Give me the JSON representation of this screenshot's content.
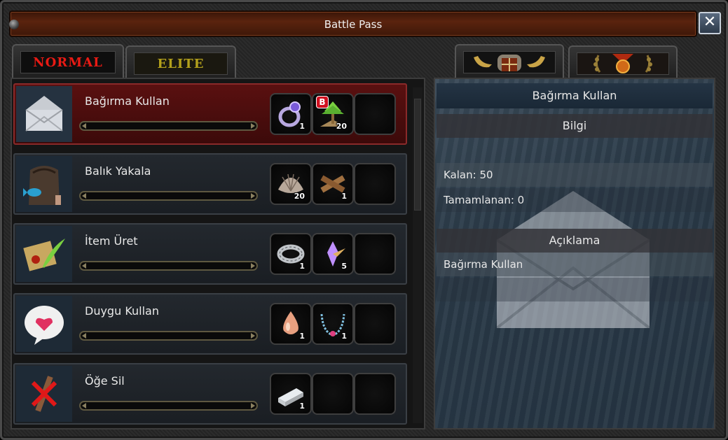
{
  "window": {
    "title": "Battle Pass",
    "close_symbol": "✕"
  },
  "tabs": {
    "normal": "NORMAL",
    "elite": "ELITE",
    "right_tab_1_icon": "gate-horns-icon",
    "right_tab_2_icon": "medal-laurel-icon"
  },
  "quests": [
    {
      "name": "Bağırma Kullan",
      "icon": "envelope-icon",
      "selected": true,
      "progress": 0,
      "rewards": [
        {
          "icon": "ring-icon",
          "count": "1"
        },
        {
          "icon": "tree-icon",
          "count": "20",
          "badge": "B"
        },
        {
          "icon": "empty-slot"
        }
      ]
    },
    {
      "name": "Balık Yakala",
      "icon": "fish-icon",
      "selected": false,
      "progress": 0,
      "rewards": [
        {
          "icon": "shell-icon",
          "count": "20"
        },
        {
          "icon": "wood-icon",
          "count": "1"
        },
        {
          "icon": "empty-slot"
        }
      ]
    },
    {
      "name": "İtem Üret",
      "icon": "scroll-feather-icon",
      "selected": false,
      "progress": 0,
      "rewards": [
        {
          "icon": "silver-ring-icon",
          "count": "1"
        },
        {
          "icon": "crystal-icon",
          "count": "5"
        },
        {
          "icon": "empty-slot"
        }
      ]
    },
    {
      "name": "Duygu Kullan",
      "icon": "heart-bubble-icon",
      "selected": false,
      "progress": 0,
      "rewards": [
        {
          "icon": "drop-icon",
          "count": "1"
        },
        {
          "icon": "necklace-icon",
          "count": "1"
        },
        {
          "icon": "empty-slot"
        }
      ]
    },
    {
      "name": "Öğe Sil",
      "icon": "crossed-item-icon",
      "selected": false,
      "progress": 0,
      "rewards": [
        {
          "icon": "silver-bar-icon",
          "count": "1"
        },
        {
          "icon": "empty-slot"
        },
        {
          "icon": "empty-slot"
        }
      ]
    }
  ],
  "detail": {
    "title": "Bağırma Kullan",
    "info_header": "Bilgi",
    "remaining": "Kalan: 50",
    "completed": "Tamamlanan: 0",
    "description_header": "Açıklama",
    "description": "Bağırma Kullan"
  },
  "colors": {
    "normal_tab": "#e81a14",
    "elite_tab": "#b3a01c",
    "selected_row": "#5a1010"
  }
}
